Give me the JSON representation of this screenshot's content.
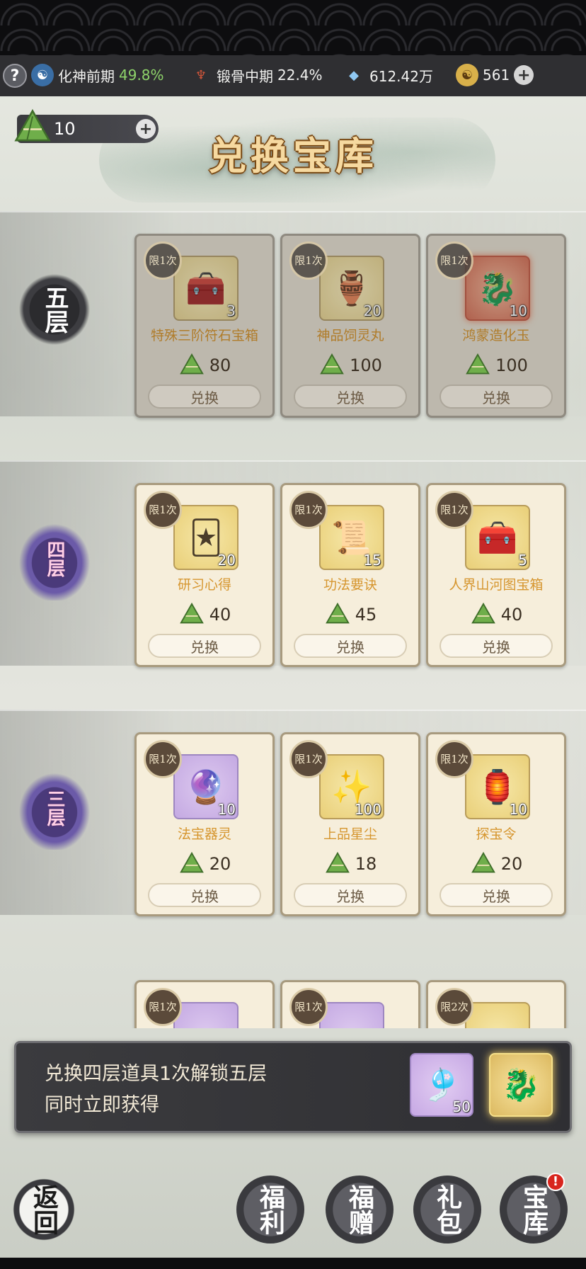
{
  "status": {
    "help": "?",
    "realm1_name": "化神前期",
    "realm1_pct": "49.8%",
    "realm2_name": "锻骨中期",
    "realm2_pct": "22.4%",
    "spirit_stones": "612.42万",
    "coins": "561",
    "plus": "+"
  },
  "header": {
    "title": "兑换宝库",
    "currency_amount": "10",
    "plus": "+"
  },
  "tiers": [
    {
      "label": "五层",
      "items": [
        {
          "limit": "限1次",
          "name": "特殊三阶符石宝箱",
          "qty": "3",
          "price": "80",
          "button": "兑换"
        },
        {
          "limit": "限1次",
          "name": "神品饲灵丸",
          "qty": "20",
          "price": "100",
          "button": "兑换"
        },
        {
          "limit": "限1次",
          "name": "鸿蒙造化玉",
          "qty": "10",
          "price": "100",
          "button": "兑换"
        }
      ]
    },
    {
      "label": "四层",
      "items": [
        {
          "limit": "限1次",
          "name": "研习心得",
          "qty": "20",
          "price": "40",
          "button": "兑换"
        },
        {
          "limit": "限1次",
          "name": "功法要诀",
          "qty": "15",
          "price": "45",
          "button": "兑换"
        },
        {
          "limit": "限1次",
          "name": "人界山河图宝箱",
          "qty": "5",
          "price": "40",
          "button": "兑换"
        }
      ]
    },
    {
      "label": "三层",
      "items": [
        {
          "limit": "限1次",
          "name": "法宝器灵",
          "qty": "10",
          "price": "20",
          "button": "兑换"
        },
        {
          "limit": "限1次",
          "name": "上品星尘",
          "qty": "100",
          "price": "18",
          "button": "兑换"
        },
        {
          "limit": "限1次",
          "name": "探宝令",
          "qty": "10",
          "price": "20",
          "button": "兑换"
        }
      ]
    },
    {
      "label": "",
      "items": [
        {
          "limit": "限1次"
        },
        {
          "limit": "限1次"
        },
        {
          "limit": "限2次"
        }
      ]
    }
  ],
  "banner": {
    "line1": "兑换四层道具1次解锁五层",
    "line2": "同时立即获得",
    "reward_qty": "50"
  },
  "nav": {
    "back": "返回",
    "welfare": "福利",
    "gift_give": "福赠",
    "pack": "礼包",
    "treasury": "宝库",
    "badge": "!"
  },
  "icons": {
    "currency": "zongzi-icon",
    "spirit_stone": "crystal-icon",
    "coin": "yin-yang-coin-icon"
  }
}
